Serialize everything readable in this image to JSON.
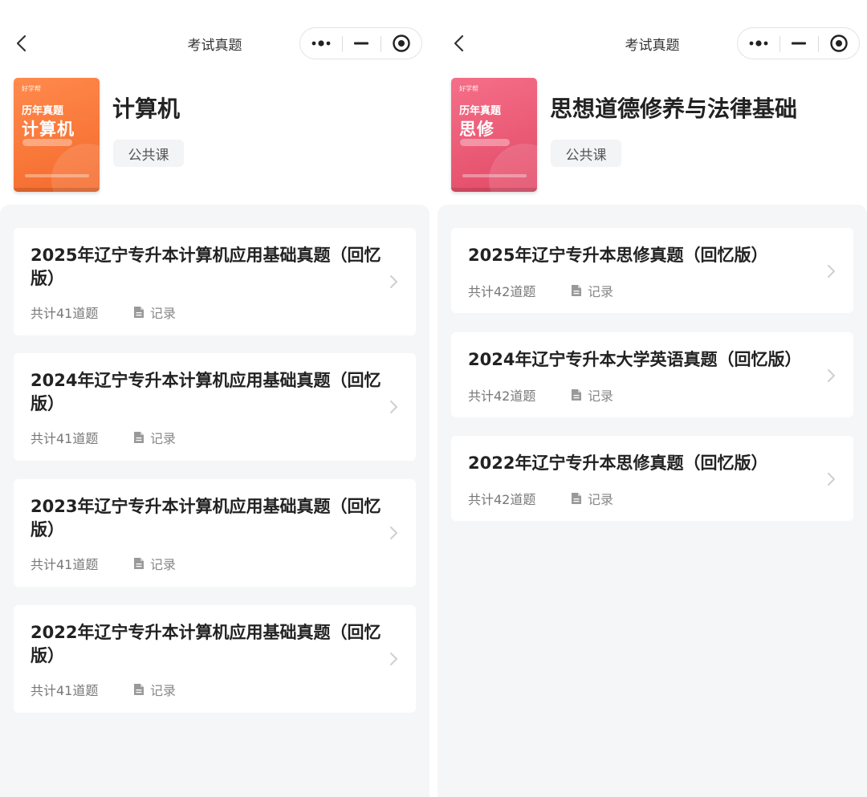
{
  "left": {
    "nav_title": "考试真题",
    "cover": {
      "brand": "好学帮",
      "line1": "历年真题",
      "line2": "计算机"
    },
    "subject_title": "计算机",
    "tag": "公共课",
    "cards": [
      {
        "title": "2025年辽宁专升本计算机应用基础真题（回忆版）",
        "count": "共计41道题",
        "record": "记录"
      },
      {
        "title": "2024年辽宁专升本计算机应用基础真题（回忆版）",
        "count": "共计41道题",
        "record": "记录"
      },
      {
        "title": "2023年辽宁专升本计算机应用基础真题（回忆版）",
        "count": "共计41道题",
        "record": "记录"
      },
      {
        "title": "2022年辽宁专升本计算机应用基础真题（回忆版）",
        "count": "共计41道题",
        "record": "记录"
      }
    ]
  },
  "right": {
    "nav_title": "考试真题",
    "cover": {
      "brand": "好学帮",
      "line1": "历年真题",
      "line2": "思修"
    },
    "subject_title": "思想道德修养与法律基础",
    "tag": "公共课",
    "cards": [
      {
        "title": "2025年辽宁专升本思修真题（回忆版）",
        "count": "共计42道题",
        "record": "记录"
      },
      {
        "title": "2024年辽宁专升本大学英语真题（回忆版）",
        "count": "共计42道题",
        "record": "记录"
      },
      {
        "title": "2022年辽宁专升本思修真题（回忆版）",
        "count": "共计42道题",
        "record": "记录"
      }
    ]
  },
  "icons": {
    "back": "chevron-left-icon",
    "more": "more-dots-icon",
    "minimize": "minus-icon",
    "close": "target-circle-icon",
    "record": "document-icon",
    "arrow": "chevron-right-icon"
  },
  "colors": {
    "cover_left": "#f46a2c",
    "cover_right": "#e24a67",
    "list_background": "#f5f6f8"
  }
}
